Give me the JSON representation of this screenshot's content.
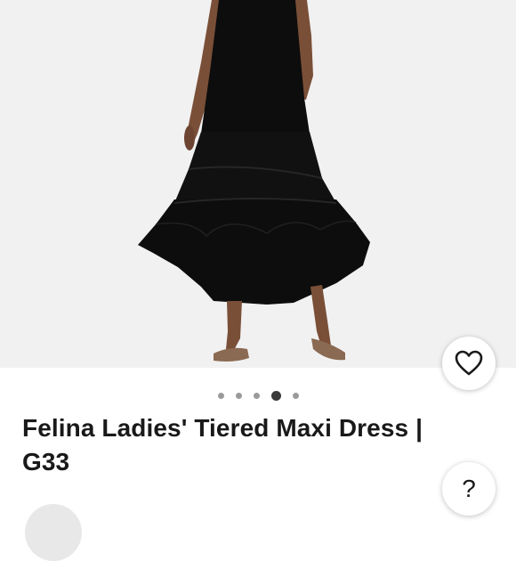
{
  "product": {
    "title": "Felina Ladies' Tiered Maxi Dress | G33"
  },
  "gallery": {
    "image_count": 5,
    "active_index": 3
  },
  "actions": {
    "favorite_icon": "heart-outline-icon",
    "help_label": "?"
  },
  "colors": {
    "background": "#ffffff",
    "image_bg": "#f1f1f1",
    "text": "#191919",
    "dress": "#0d0d0d"
  }
}
